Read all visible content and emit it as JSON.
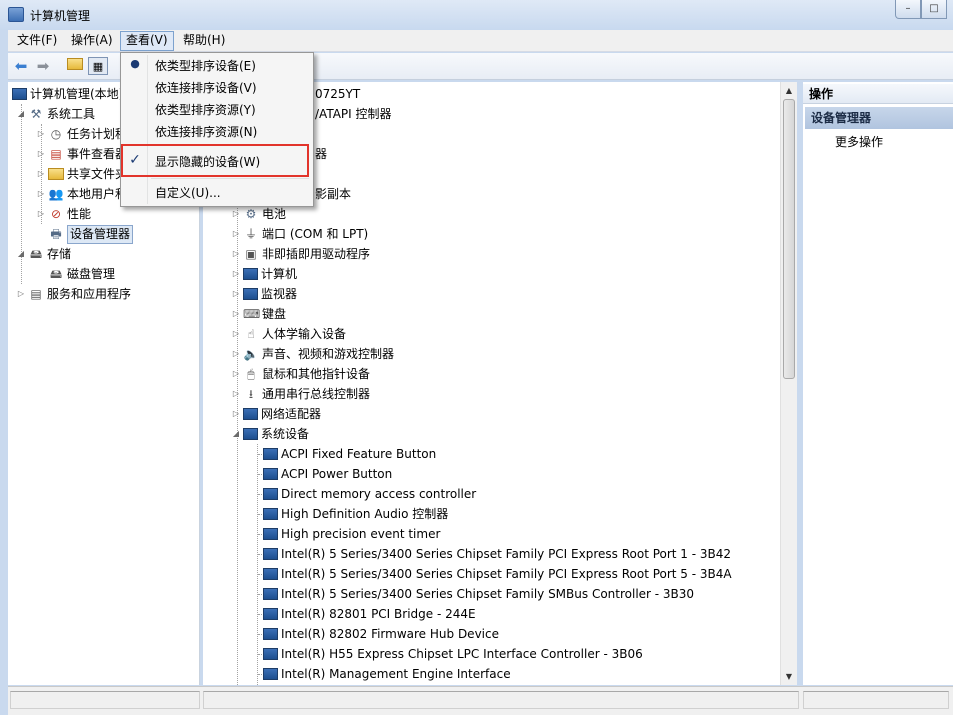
{
  "window": {
    "title": "计算机管理",
    "buttons": [
      "–",
      "□"
    ]
  },
  "menubar": {
    "items": [
      "文件(F)",
      "操作(A)",
      "查看(V)",
      "帮助(H)"
    ]
  },
  "view_menu": {
    "items": [
      "依类型排序设备(E)",
      "依连接排序设备(V)",
      "依类型排序资源(Y)",
      "依连接排序资源(N)",
      "显示隐藏的设备(W)",
      "自定义(U)..."
    ],
    "bullet": "●",
    "check": "✓"
  },
  "left_tree": {
    "root": "计算机管理(本地)",
    "system_tools": "系统工具",
    "task_scheduler": "任务计划程序",
    "event_viewer": "事件查看器",
    "shared_folders": "共享文件夹",
    "local_users": "本地用户和组",
    "performance": "性能",
    "device_manager": "设备管理器",
    "storage": "存储",
    "disk_management": "磁盘管理",
    "services_apps": "服务和应用程序"
  },
  "device_tree": {
    "computer_name_partial": "0725YT",
    "ide_partial": "/ATAPI 控制器",
    "row2_partial": "器",
    "volume_shadow_partial": "影副本",
    "categories": [
      "电池",
      "端口 (COM 和 LPT)",
      "非即插即用驱动程序",
      "计算机",
      "监视器",
      "键盘",
      "人体学输入设备",
      "声音、视频和游戏控制器",
      "鼠标和其他指针设备",
      "通用串行总线控制器",
      "网络适配器",
      "系统设备"
    ],
    "system_devices": [
      "ACPI Fixed Feature Button",
      "ACPI Power Button",
      "Direct memory access controller",
      "High Definition Audio 控制器",
      "High precision event timer",
      "Intel(R) 5 Series/3400 Series Chipset Family PCI Express Root Port 1 - 3B42",
      "Intel(R) 5 Series/3400 Series Chipset Family PCI Express Root Port 5 - 3B4A",
      "Intel(R) 5 Series/3400 Series Chipset Family SMBus Controller - 3B30",
      "Intel(R) 82801 PCI Bridge - 244E",
      "Intel(R) 82802 Firmware Hub Device",
      "Intel(R) H55 Express Chipset LPC Interface Controller - 3B06",
      "Intel(R) Management Engine Interface"
    ]
  },
  "actions": {
    "header": "操作",
    "section": "设备管理器",
    "more": "更多操作"
  },
  "icons": [
    "back-arrow-icon",
    "forward-arrow-icon",
    "up-folder-icon",
    "show-hide-tree-icon",
    "monitor-icon",
    "gear-icon",
    "folder-icon"
  ]
}
